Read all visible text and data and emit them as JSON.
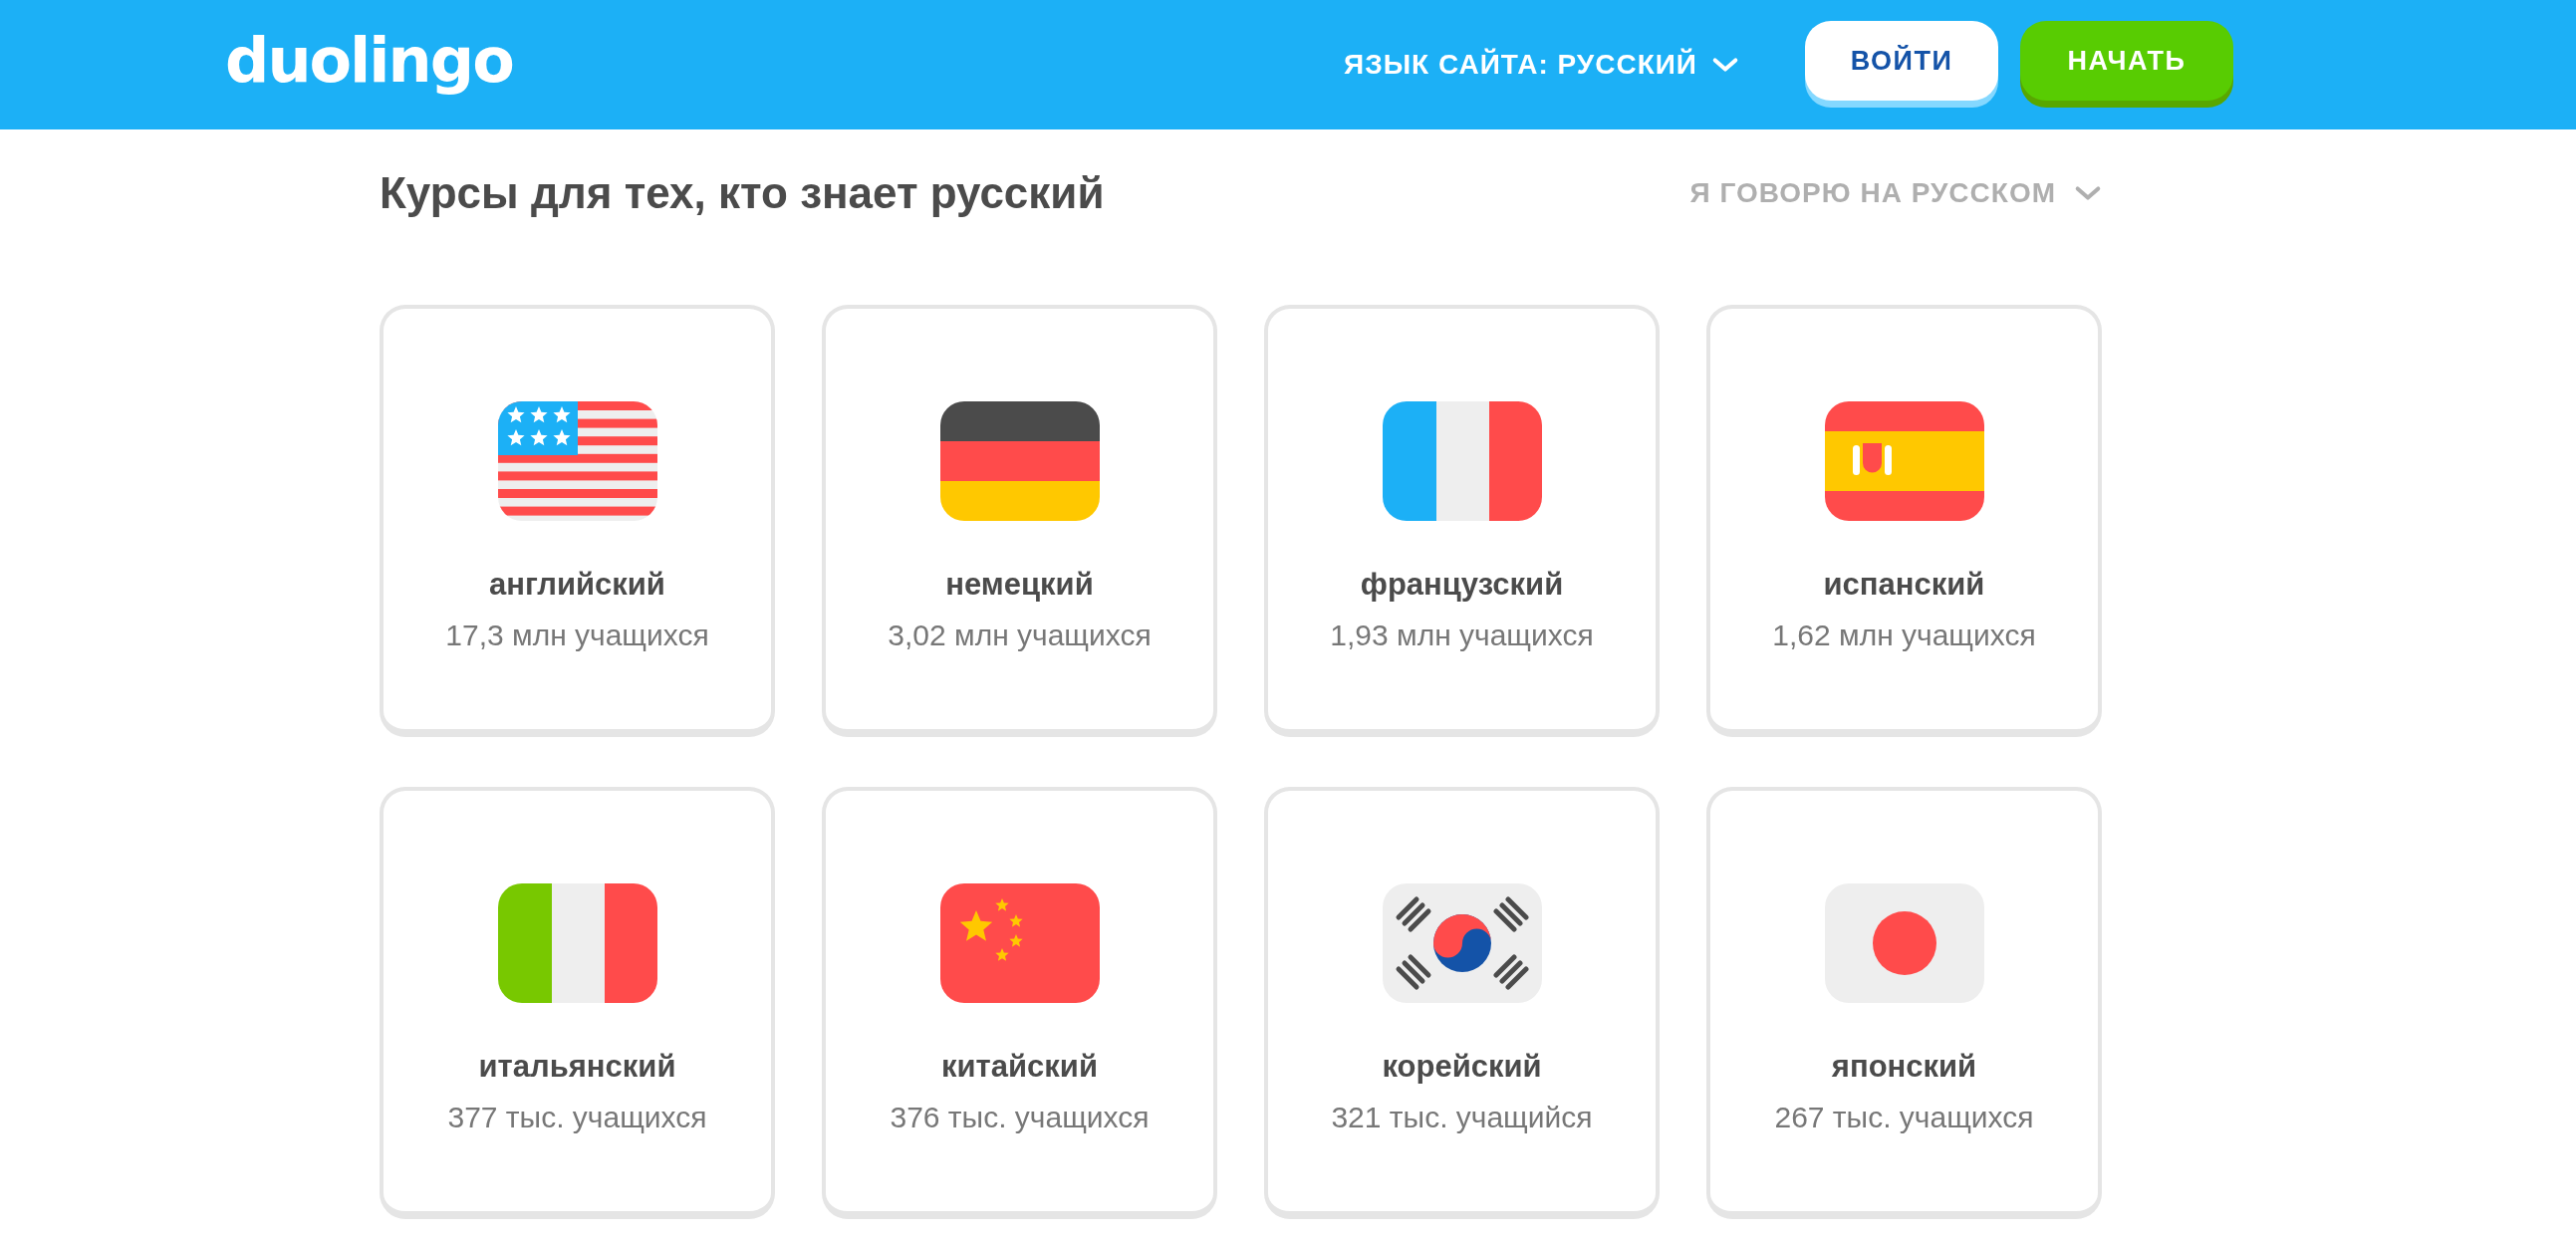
{
  "header": {
    "logo": "duolingo",
    "site_language": "ЯЗЫК САЙТА: РУССКИЙ",
    "buttons": [
      {
        "label": "ВОЙТИ",
        "kind": "secondary"
      },
      {
        "label": "НАЧАТЬ",
        "kind": "primary"
      }
    ]
  },
  "heading": "Курсы для тех, кто знает русский",
  "speaker_language": "Я ГОВОРЮ НА РУССКОМ",
  "courses": [
    {
      "name": "английский",
      "learners": "17,3 млн учащихся",
      "kind": "us"
    },
    {
      "name": "немецкий",
      "learners": "3,02 млн учащихся",
      "kind": "de"
    },
    {
      "name": "французский",
      "learners": "1,93 млн учащихся",
      "kind": "fr"
    },
    {
      "name": "испанский",
      "learners": "1,62 млн учащихся",
      "kind": "es"
    },
    {
      "name": "итальянский",
      "learners": "377 тыс. учащихся",
      "kind": "it"
    },
    {
      "name": "китайский",
      "learners": "376 тыс. учащихся",
      "kind": "cn"
    },
    {
      "name": "корейский",
      "learners": "321 тыс. учащийся",
      "kind": "kr"
    },
    {
      "name": "японский",
      "learners": "267 тыс. учащихся",
      "kind": "jp"
    }
  ]
}
